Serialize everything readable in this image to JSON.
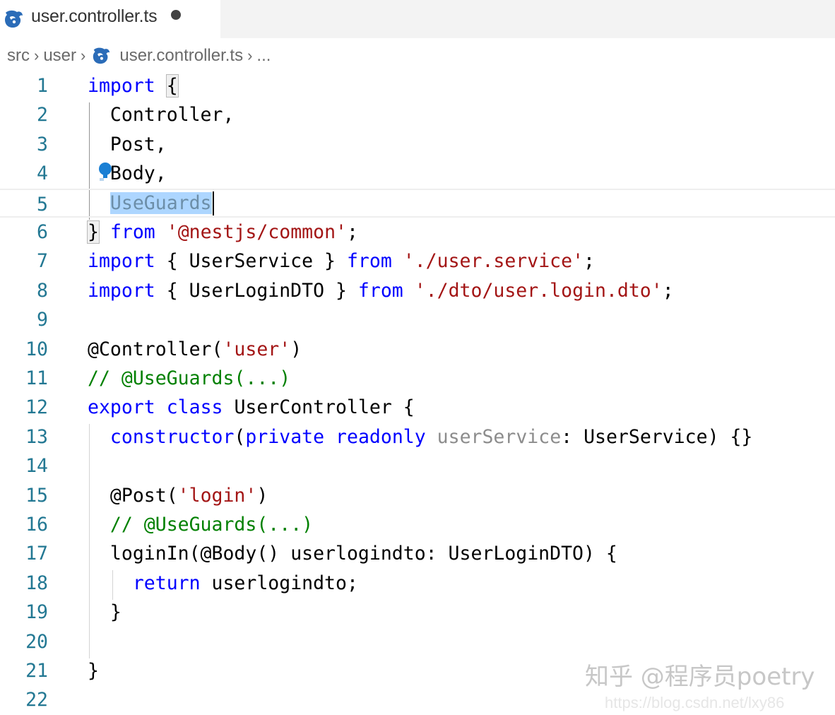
{
  "tab": {
    "filename": "user.controller.ts",
    "icon": "nestjs-icon",
    "modified": true
  },
  "breadcrumb": {
    "items": [
      "src",
      "user",
      "user.controller.ts",
      "..."
    ]
  },
  "editor": {
    "lines": [
      "1",
      "2",
      "3",
      "4",
      "5",
      "6",
      "7",
      "8",
      "9",
      "10",
      "11",
      "12",
      "13",
      "14",
      "15",
      "16",
      "17",
      "18",
      "19",
      "20",
      "21",
      "22"
    ],
    "code": {
      "l1_kw": "import",
      "l1_rest": "{",
      "l2": "Controller,",
      "l3": "Post,",
      "l4": "Body,",
      "l5": "UseGuards",
      "l6_brace": "}",
      "l6_from": "from",
      "l6_str": "'@nestjs/common'",
      "l6_end": ";",
      "l7_kw": "import",
      "l7_mid": " { UserService } ",
      "l7_from": "from",
      "l7_str": "'./user.service'",
      "l7_end": ";",
      "l8_kw": "import",
      "l8_mid": " { UserLoginDTO } ",
      "l8_from": "from",
      "l8_str": "'./dto/user.login.dto'",
      "l8_end": ";",
      "l10_a": "@Controller(",
      "l10_str": "'user'",
      "l10_b": ")",
      "l11": "// @UseGuards(...)",
      "l12_kw1": "export",
      "l12_kw2": "class",
      "l12_rest": "UserController {",
      "l13_kw": "constructor",
      "l13_p": "(",
      "l13_kw2": "private",
      "l13_kw3": "readonly",
      "l13_dim": "userService",
      "l13_rest": ": UserService) {}",
      "l15_a": "@Post(",
      "l15_str": "'login'",
      "l15_b": ")",
      "l16": "// @UseGuards(...)",
      "l17": "loginIn(@Body() userlogindto: UserLoginDTO) {",
      "l18_kw": "return",
      "l18_rest": " userlogindto;",
      "l19": "}",
      "l21": "}"
    },
    "colors": {
      "keyword": "#0000ff",
      "string": "#a31515",
      "comment": "#008000",
      "line_number": "#237893",
      "selection": "#add6ff"
    }
  },
  "watermark": {
    "text": "知乎 @程序员poetry",
    "url": "https://blog.csdn.net/lxy86"
  }
}
